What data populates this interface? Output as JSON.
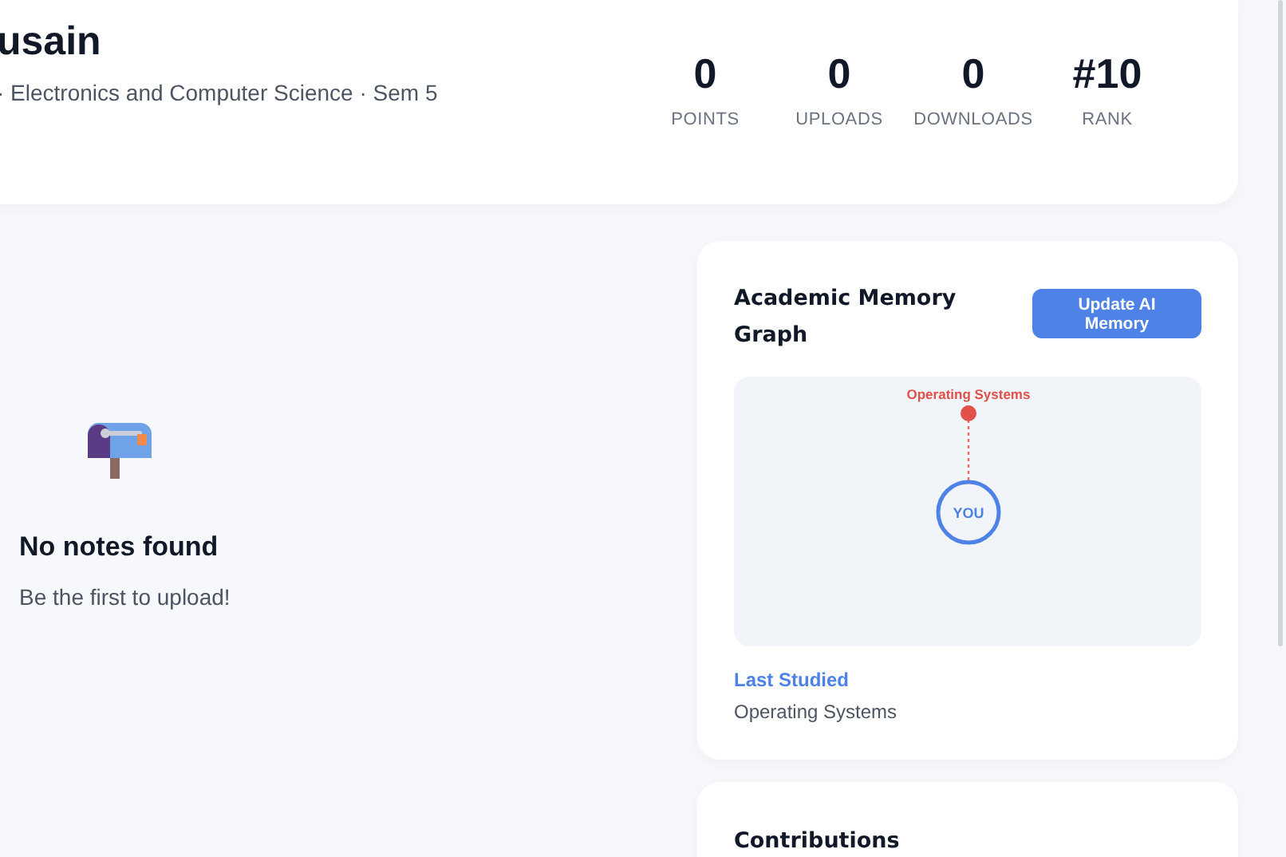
{
  "profile": {
    "name": "usain",
    "details": "· Electronics and Computer Science · Sem 5"
  },
  "stats": [
    {
      "value": "0",
      "label": "POINTS"
    },
    {
      "value": "0",
      "label": "UPLOADS"
    },
    {
      "value": "0",
      "label": "DOWNLOADS"
    },
    {
      "value": "#10",
      "label": "RANK"
    }
  ],
  "notes": {
    "title": "No notes found",
    "message": "Be the first to upload!"
  },
  "memory_graph": {
    "title": "Academic Memory Graph",
    "button": "Update AI Memory",
    "center": "YOU",
    "nodes": [
      {
        "label": "Operating Systems"
      }
    ],
    "last_studied_label": "Last Studied",
    "last_studied": "Operating Systems"
  },
  "contributions": {
    "title": "Contributions"
  }
}
